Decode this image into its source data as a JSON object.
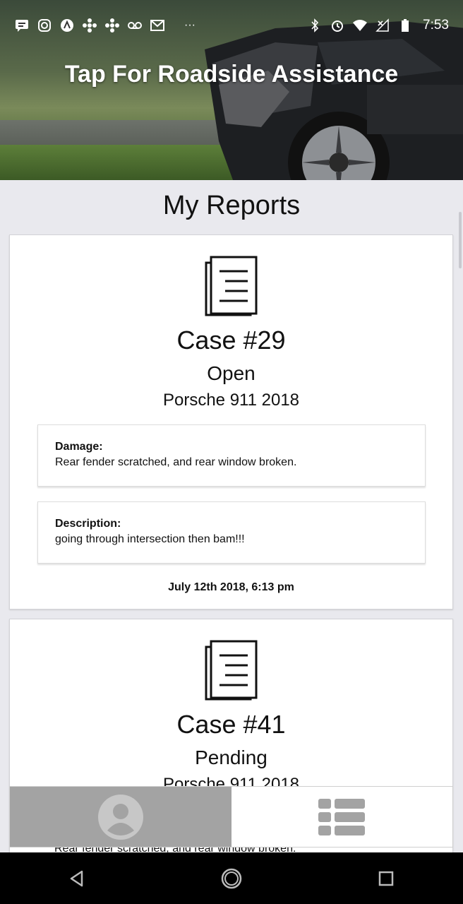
{
  "status_bar": {
    "time": "7:53",
    "left_icons": [
      "message-icon",
      "instagram-icon",
      "app-a-icon",
      "cbc-icon",
      "cbc-icon",
      "voicemail-icon",
      "gmail-icon",
      "more-dots-icon"
    ],
    "right_icons": [
      "bluetooth-icon",
      "alarm-icon",
      "wifi-icon",
      "no-signal-icon",
      "battery-icon"
    ]
  },
  "hero": {
    "title": "Tap For Roadside Assistance",
    "image": "damaged-car-photo"
  },
  "reports": {
    "title": "My Reports",
    "cards": [
      {
        "case": "Case #29",
        "status": "Open",
        "vehicle": "Porsche 911 2018",
        "damage_label": "Damage:",
        "damage_text": "Rear fender scratched, and rear window broken.",
        "description_label": "Description:",
        "description_text": "going through intersection then bam!!!",
        "date": "July 12th 2018, 6:13 pm"
      },
      {
        "case": "Case #41",
        "status": "Pending",
        "vehicle": "Porsche 911 2018",
        "damage_peek": "Rear fender scratched, and rear window broken."
      }
    ]
  },
  "bottom_tabs": [
    {
      "icon": "profile-icon",
      "active": true
    },
    {
      "icon": "list-view-icon",
      "active": false
    }
  ],
  "nav_bar": {
    "buttons": [
      "back-icon",
      "home-icon",
      "recents-icon"
    ]
  }
}
